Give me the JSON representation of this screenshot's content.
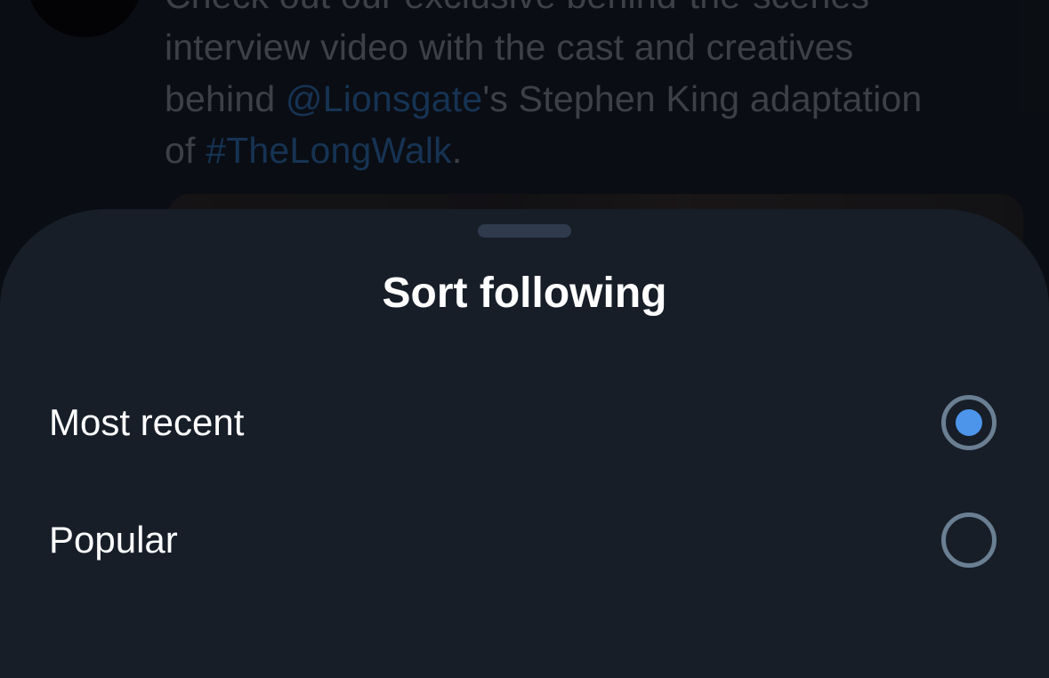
{
  "background_tweet": {
    "line1": "Check out our exclusive behind-the-scenes",
    "line2": "interview video with the cast and creatives",
    "line3_pre": "behind ",
    "line3_mention": "@Lionsgate",
    "line3_post": "'s Stephen King adaptation",
    "line4_pre": "of ",
    "line4_hashtag": "#TheLongWalk",
    "line4_post": "."
  },
  "sheet": {
    "title": "Sort following",
    "options": [
      {
        "label": "Most recent",
        "selected": true
      },
      {
        "label": "Popular",
        "selected": false
      }
    ]
  },
  "colors": {
    "sheet_background": "#171e28",
    "accent": "#4d95ea",
    "radio_ring": "#6b7f93",
    "link": "#1e4a78"
  }
}
